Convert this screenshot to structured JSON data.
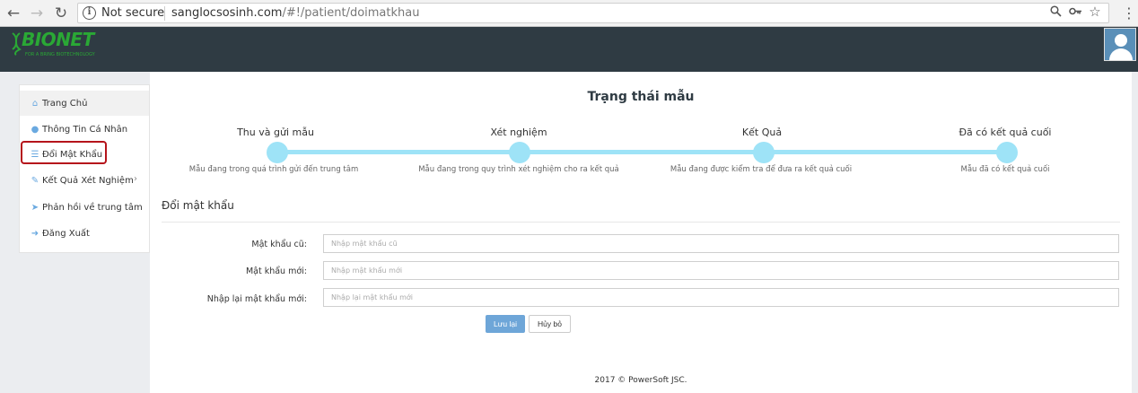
{
  "browser": {
    "security_label": "Not secure",
    "url_host": "sanglocsosinh.com",
    "url_path": "/#!/patient/doimatkhau"
  },
  "header": {
    "logo_text": "BIONET",
    "logo_tagline": "FOR A BRING BIOTECHNOLOGY"
  },
  "sidebar": {
    "items": [
      {
        "label": "Trang Chủ",
        "icon": "home-icon"
      },
      {
        "label": "Thông Tin Cá Nhân",
        "icon": "user-icon"
      },
      {
        "label": "Đổi Mật Khẩu",
        "icon": "list-icon"
      },
      {
        "label": "Kết Quả Xét Nghiệm",
        "icon": "edit-icon"
      },
      {
        "label": "Phản hồi về trung tâm",
        "icon": "paper-plane-icon"
      },
      {
        "label": "Đăng Xuất",
        "icon": "sign-out-icon"
      }
    ]
  },
  "status": {
    "title": "Trạng thái mẫu",
    "steps": [
      {
        "label": "Thu và gửi mẫu",
        "desc": "Mẫu đang trong quá trình gửi đến trung tâm"
      },
      {
        "label": "Xét nghiệm",
        "desc": "Mẫu đang trong quy trình xét nghiệm cho ra kết quả"
      },
      {
        "label": "Kết Quả",
        "desc": "Mẫu đang được kiểm tra để đưa ra kết quả cuối"
      },
      {
        "label": "Đã có kết quả cuối",
        "desc": "Mẫu đã có kết quả cuối"
      }
    ]
  },
  "form": {
    "title": "Đổi mật khẩu",
    "old_password": {
      "label": "Mật khẩu cũ:",
      "placeholder": "Nhập mật khẩu cũ",
      "value": ""
    },
    "new_password": {
      "label": "Mật khẩu mới:",
      "placeholder": "Nhập mật khẩu mới",
      "value": ""
    },
    "confirm_password": {
      "label": "Nhập lại mật khẩu mới:",
      "placeholder": "Nhập lại mật khẩu mới",
      "value": ""
    },
    "save_label": "Lưu lại",
    "cancel_label": "Hủy bỏ"
  },
  "footer": {
    "copyright": "2017 © PowerSoft JSC."
  }
}
